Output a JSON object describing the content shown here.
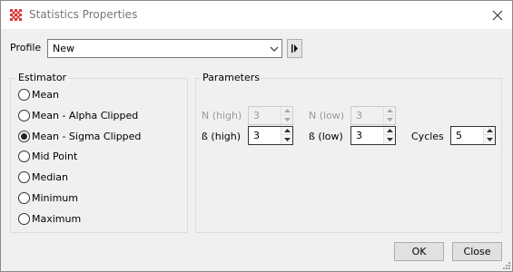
{
  "window": {
    "title": "Statistics Properties",
    "icon": "grid-app-icon",
    "accent": "#e23a3a"
  },
  "profile": {
    "label": "Profile",
    "value": "New"
  },
  "estimator": {
    "title": "Estimator",
    "options": [
      {
        "label": "Mean",
        "selected": false
      },
      {
        "label": "Mean - Alpha Clipped",
        "selected": false
      },
      {
        "label": "Mean - Sigma Clipped",
        "selected": true
      },
      {
        "label": "Mid Point",
        "selected": false
      },
      {
        "label": "Median",
        "selected": false
      },
      {
        "label": "Minimum",
        "selected": false
      },
      {
        "label": "Maximum",
        "selected": false
      }
    ]
  },
  "parameters": {
    "title": "Parameters",
    "n_high": {
      "label": "N (high)",
      "value": "3",
      "enabled": false
    },
    "n_low": {
      "label": "N (low)",
      "value": "3",
      "enabled": false
    },
    "b_high": {
      "label": "ß (high)",
      "value": "3",
      "enabled": true
    },
    "b_low": {
      "label": "ß (low)",
      "value": "3",
      "enabled": true
    },
    "cycles": {
      "label": "Cycles",
      "value": "5",
      "enabled": true
    }
  },
  "buttons": {
    "ok": "OK",
    "close": "Close"
  }
}
